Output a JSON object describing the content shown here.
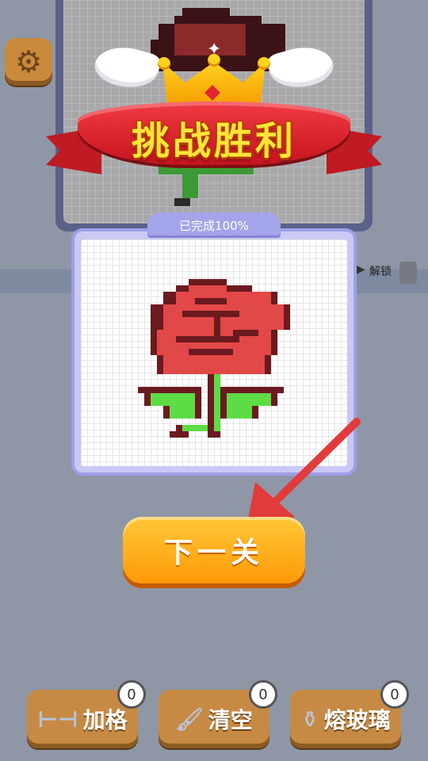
{
  "victory": {
    "title": "挑战胜利"
  },
  "progress": {
    "label": "已完成100%",
    "percent": 100
  },
  "unlock": {
    "label": "解锁"
  },
  "next_button": {
    "label": "下一关"
  },
  "tools": [
    {
      "label": "加格",
      "count": "0",
      "icon": "rubber-band-icon"
    },
    {
      "label": "清空",
      "count": "0",
      "icon": "brush-icon"
    },
    {
      "label": "熔玻璃",
      "count": "0",
      "icon": "potion-bottle-icon"
    }
  ],
  "colors": {
    "rose_red": "#e34848",
    "rose_dark": "#6b1a1f",
    "leaf_green": "#5ddc45",
    "button_orange": "#ffab17"
  },
  "icons": [
    "gear-icon",
    "crown-icon",
    "wings-icon",
    "camera-icon",
    "arrow-icon"
  ]
}
